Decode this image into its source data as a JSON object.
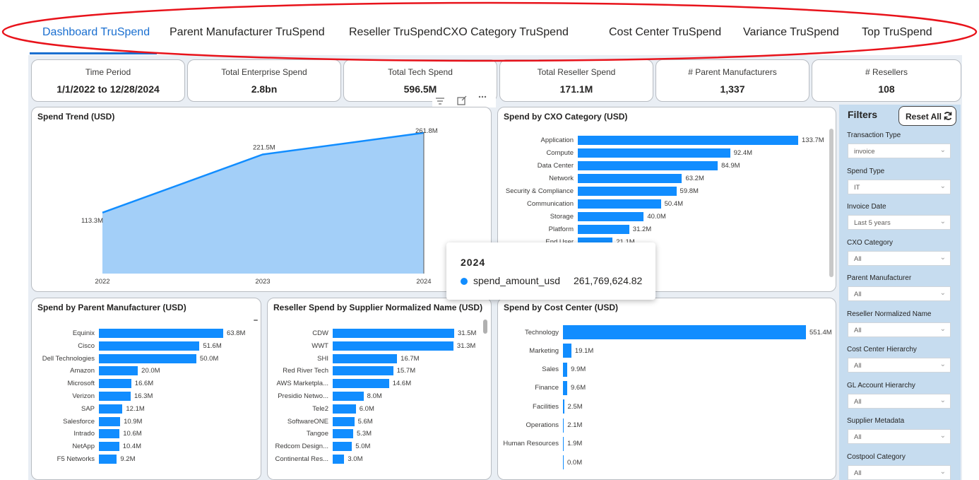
{
  "tabs": [
    {
      "label": "Dashboard TruSpend"
    },
    {
      "label": "Parent Manufacturer TruSpend"
    },
    {
      "label": "Reseller TruSpend"
    },
    {
      "label": "CXO Category TruSpend"
    },
    {
      "label": "Cost Center TruSpend"
    },
    {
      "label": "Variance TruSpend"
    },
    {
      "label": "Top TruSpend"
    }
  ],
  "kpis": [
    {
      "label": "Time Period",
      "value": "1/1/2022 to 12/28/2024"
    },
    {
      "label": "Total Enterprise Spend",
      "value": "2.8bn"
    },
    {
      "label": "Total Tech Spend",
      "value": "596.5M"
    },
    {
      "label": "Total Reseller Spend",
      "value": "171.1M"
    },
    {
      "label": "# Parent Manufacturers",
      "value": "1,337"
    },
    {
      "label": "# Resellers",
      "value": "108"
    }
  ],
  "visual_header_icons": [
    "filter-icon",
    "focus-mode-icon",
    "more-options-icon"
  ],
  "filters": {
    "title": "Filters",
    "reset_label": "Reset All",
    "items": [
      {
        "label": "Transaction Type",
        "value": "invoice"
      },
      {
        "label": "Spend Type",
        "value": "IT"
      },
      {
        "label": "Invoice Date",
        "value": "Last 5 years"
      },
      {
        "label": "CXO Category",
        "value": "All"
      },
      {
        "label": "Parent Manufacturer",
        "value": "All"
      },
      {
        "label": "Reseller Normalized Name",
        "value": "All"
      },
      {
        "label": "Cost Center Hierarchy",
        "value": "All"
      },
      {
        "label": "GL Account Hierarchy",
        "value": "All"
      },
      {
        "label": "Supplier Metadata",
        "value": "All"
      },
      {
        "label": "Costpool Category",
        "value": "All"
      }
    ]
  },
  "tooltip": {
    "title": "2024",
    "series": "spend_amount_usd",
    "value": "261,769,624.82"
  },
  "colors": {
    "bar": "#118dff",
    "area": "#a3cff8",
    "line": "#118dff",
    "accent": "#1a6fd0",
    "highlight": "#e8131b",
    "filter_bg": "#c6dcef"
  },
  "chart_data": [
    {
      "type": "area",
      "title": "Spend Trend (USD)",
      "categories": [
        "2022",
        "2023",
        "2024"
      ],
      "values": [
        113.3,
        221.5,
        261.8
      ],
      "labels": [
        "113.3M",
        "221.5M",
        "261.8M"
      ]
    },
    {
      "type": "bar",
      "title": "Spend by CXO Category (USD)",
      "categories": [
        "Application",
        "Compute",
        "Data Center",
        "Network",
        "Security & Compliance",
        "Communication",
        "Storage",
        "Platform",
        "End User"
      ],
      "values": [
        133.7,
        92.4,
        84.9,
        63.2,
        59.8,
        50.4,
        40.0,
        31.2,
        21.1
      ],
      "labels": [
        "133.7M",
        "92.4M",
        "84.9M",
        "63.2M",
        "59.8M",
        "50.4M",
        "40.0M",
        "31.2M",
        "21.1M"
      ]
    },
    {
      "type": "bar",
      "title": "Spend by Parent Manufacturer (USD)",
      "categories": [
        "Equinix",
        "Cisco",
        "Dell Technologies",
        "Amazon",
        "Microsoft",
        "Verizon",
        "SAP",
        "Salesforce",
        "Intrado",
        "NetApp",
        "F5 Networks"
      ],
      "values": [
        63.8,
        51.6,
        50.0,
        20.0,
        16.6,
        16.3,
        12.1,
        10.9,
        10.6,
        10.4,
        9.2
      ],
      "labels": [
        "63.8M",
        "51.6M",
        "50.0M",
        "20.0M",
        "16.6M",
        "16.3M",
        "12.1M",
        "10.9M",
        "10.6M",
        "10.4M",
        "9.2M"
      ]
    },
    {
      "type": "bar",
      "title": "Reseller Spend by Supplier Normalized Name (USD)",
      "categories": [
        "CDW",
        "WWT",
        "SHI",
        "Red River Tech",
        "AWS Marketpla...",
        "Presidio Netwo...",
        "Tele2",
        "SoftwareONE",
        "Tangoe",
        "Redcom Design...",
        "Continental Res..."
      ],
      "values": [
        31.5,
        31.3,
        16.7,
        15.7,
        14.6,
        8.0,
        6.0,
        5.6,
        5.3,
        5.0,
        3.0
      ],
      "labels": [
        "31.5M",
        "31.3M",
        "16.7M",
        "15.7M",
        "14.6M",
        "8.0M",
        "6.0M",
        "5.6M",
        "5.3M",
        "5.0M",
        "3.0M"
      ]
    },
    {
      "type": "bar",
      "title": "Spend by Cost Center (USD)",
      "categories": [
        "Technology",
        "Marketing",
        "Sales",
        "Finance",
        "Facilities",
        "Operations",
        "Human Resources",
        ""
      ],
      "values": [
        551.4,
        19.1,
        9.9,
        9.6,
        2.5,
        2.1,
        1.9,
        0.0
      ],
      "labels": [
        "551.4M",
        "19.1M",
        "9.9M",
        "9.6M",
        "2.5M",
        "2.1M",
        "1.9M",
        "0.0M"
      ]
    }
  ]
}
